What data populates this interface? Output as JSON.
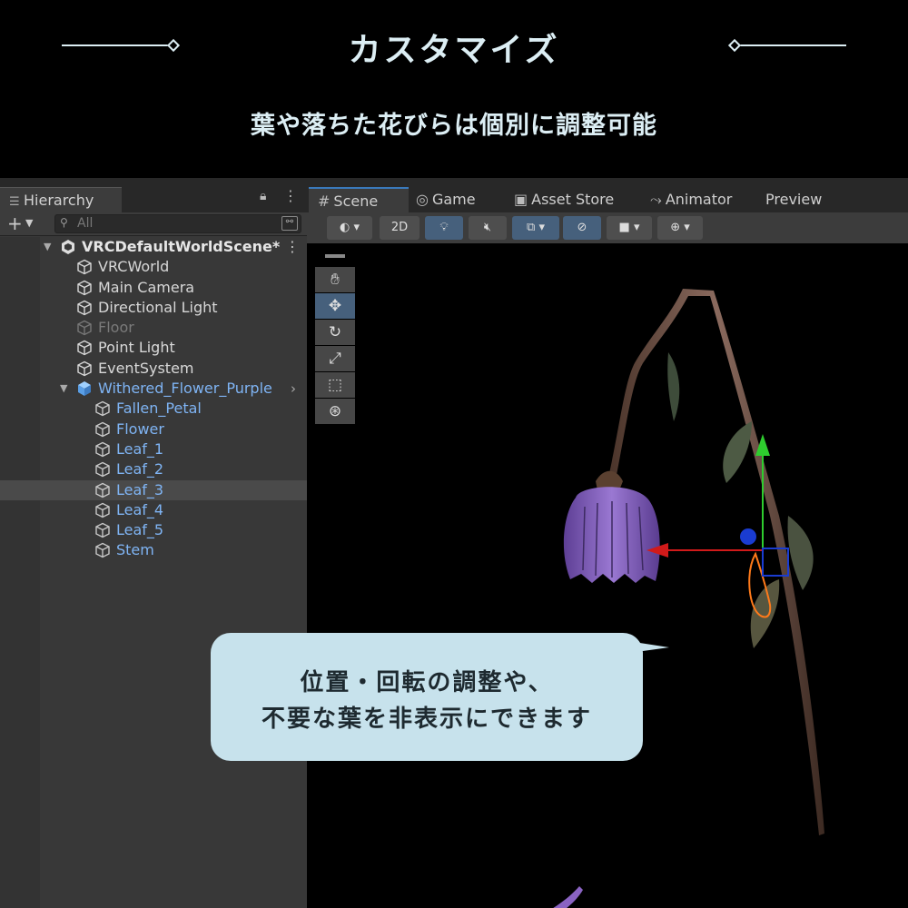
{
  "banner": {
    "title": "カスタマイズ",
    "subtitle": "葉や落ちた花びらは個別に調整可能"
  },
  "hierarchy": {
    "tab_label": "Hierarchy",
    "add_label": "+",
    "search_placeholder": "All",
    "rows": [
      {
        "label": "VRCDefaultWorldScene*",
        "kind": "root"
      },
      {
        "label": "VRCWorld",
        "kind": "normal"
      },
      {
        "label": "Main Camera",
        "kind": "normal"
      },
      {
        "label": "Directional Light",
        "kind": "normal"
      },
      {
        "label": "Floor",
        "kind": "disabled"
      },
      {
        "label": "Point Light",
        "kind": "normal"
      },
      {
        "label": "EventSystem",
        "kind": "normal"
      },
      {
        "label": "Withered_Flower_Purple",
        "kind": "prefab-root"
      },
      {
        "label": "Fallen_Petal",
        "kind": "prefab"
      },
      {
        "label": "Flower",
        "kind": "prefab"
      },
      {
        "label": "Leaf_1",
        "kind": "prefab"
      },
      {
        "label": "Leaf_2",
        "kind": "prefab"
      },
      {
        "label": "Leaf_3",
        "kind": "prefab",
        "selected": true
      },
      {
        "label": "Leaf_4",
        "kind": "prefab"
      },
      {
        "label": "Leaf_5",
        "kind": "prefab"
      },
      {
        "label": "Stem",
        "kind": "prefab"
      }
    ]
  },
  "scene_tabs": {
    "scene": "Scene",
    "game": "Game",
    "asset_store": "Asset Store",
    "animator": "Animator",
    "preview": "Preview"
  },
  "scene_toolbar": {
    "mode_2d": "2D"
  },
  "callout": {
    "line1": "位置・回転の調整や、",
    "line2": "不要な葉を非表示にできます"
  },
  "colors": {
    "prefab_text": "#7fb4f4",
    "tab_accent": "#3a79bb",
    "callout_bg": "#c7e2ec",
    "gizmo_x": "#d11a1a",
    "gizmo_y": "#2ecc2e",
    "gizmo_z": "#1a3cd1",
    "petal": "#8a63c2"
  }
}
